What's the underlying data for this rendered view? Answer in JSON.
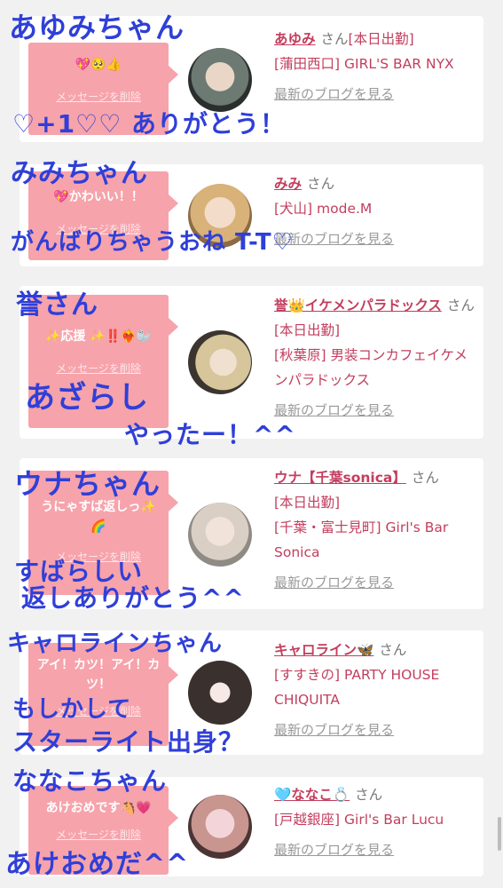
{
  "cards": [
    {
      "message": "💖🥺👍",
      "delete_label": "メッセージを削除",
      "name": "あゆみ",
      "suffix": "さん",
      "status": "[本日出勤]",
      "shop": "[蒲田西口] GIRL'S BAR NYX",
      "blog_link": "最新のブログを見る"
    },
    {
      "message": "💖かわいい！！",
      "delete_label": "メッセージを削除",
      "name": "みみ",
      "suffix": "さん",
      "status": "",
      "shop": "[犬山] mode.M",
      "blog_link": "最新のブログを見る"
    },
    {
      "message": "✨応援 ✨‼️❤️‍🔥🦭",
      "delete_label": "メッセージを削除",
      "name": "誉👑イケメンパラドックス",
      "suffix": "さん",
      "status": "[本日出勤]",
      "shop": "[秋葉原] 男装コンカフェイケメンパラドックス",
      "blog_link": "最新のブログを見る"
    },
    {
      "message": "うにゃすば返しっ✨🌈",
      "delete_label": "メッセージを削除",
      "name": "ウナ【千葉sonica】",
      "suffix": "さん",
      "status": "[本日出勤]",
      "shop": "[千葉・富士見町] Girl's Bar Sonica",
      "blog_link": "最新のブログを見る"
    },
    {
      "message": "アイ！カツ！アイ！カツ！",
      "delete_label": "メッセージを削除",
      "name": "キャロライン🦋",
      "suffix": "さん",
      "status": "",
      "shop": "[すすきの] PARTY HOUSE CHIQUITA",
      "blog_link": "最新のブログを見る"
    },
    {
      "message": "あけおめです🐴💗",
      "delete_label": "メッセージを削除",
      "name": "🩵ななこ💍",
      "suffix": "さん",
      "status": "",
      "shop": "[戸越銀座] Girl's Bar Lucu",
      "blog_link": "最新のブログを見る"
    }
  ],
  "annotations": [
    "あゆみちゃん",
    "♡+1♡♡ ありがとう！",
    "みみちゃん",
    "がんばりちゃうおね T-T♡",
    "誉さん",
    "あざらし",
    "やったー！^^",
    "ウナちゃん",
    "すばらしい",
    "返しありがとう^^",
    "キャロラインちゃん",
    "もしかして",
    "スターライト出身？",
    "ななこちゃん",
    "あけおめだ^^"
  ],
  "colors": {
    "accent": "#c33e5e",
    "bubble": "#f6a3ab",
    "ink": "#2f3fd8"
  }
}
